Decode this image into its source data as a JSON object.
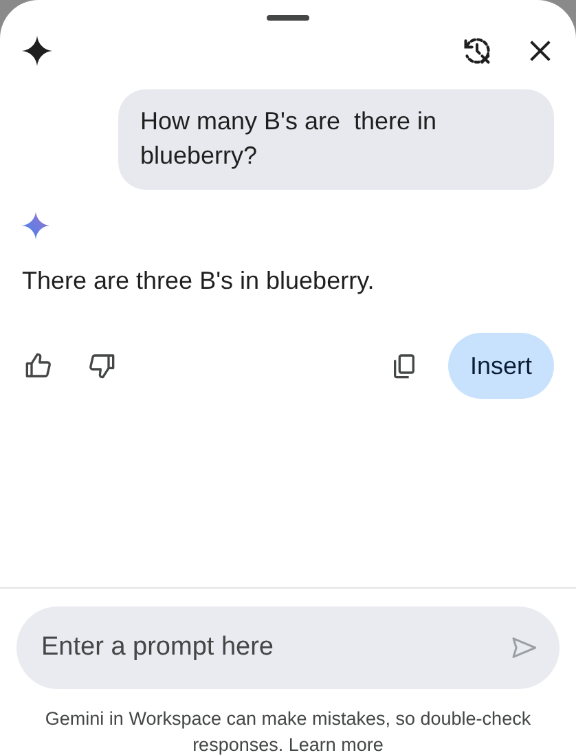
{
  "conversation": {
    "user_message": "How many B's are  there in blueberry?",
    "response": "There are three B's in blueberry.",
    "actions": {
      "insert_label": "Insert"
    }
  },
  "prompt": {
    "placeholder": "Enter a prompt here"
  },
  "disclaimer": {
    "text": "Gemini in Workspace can make mistakes, so double-check responses.",
    "link": "Learn more"
  }
}
